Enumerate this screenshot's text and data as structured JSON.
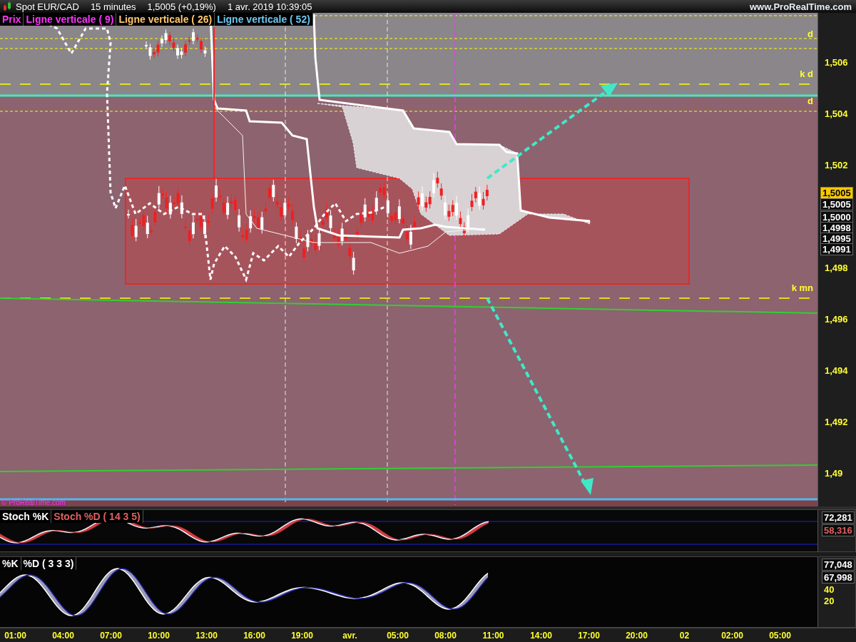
{
  "header": {
    "symbol": "Spot EUR/CAD",
    "interval": "15 minutes",
    "price": "1,5005 (+0,19%)",
    "datetime": "1 avr. 2019 10:39:05",
    "site": "www.ProRealTime.com"
  },
  "legend": [
    "Prix",
    "Ligne verticale ( 9)",
    "Ligne verticale ( 26)",
    "Ligne verticale ( 52)"
  ],
  "level_labels": [
    "d",
    "k d",
    "d",
    "k mn"
  ],
  "copyright": "© ProRealTime.com",
  "price_axis": {
    "ticks": [
      "1,506",
      "1,504",
      "1,502",
      "1,498",
      "1,496",
      "1,494",
      "1,492",
      "1,49"
    ],
    "tags": [
      {
        "value": "1,5005",
        "kind": "current"
      },
      {
        "value": "1,5005",
        "kind": "line"
      },
      {
        "value": "1,5000",
        "kind": "line"
      },
      {
        "value": "1,4998",
        "kind": "line"
      },
      {
        "value": "1,4995",
        "kind": "line"
      },
      {
        "value": "1,4991",
        "kind": "line"
      }
    ]
  },
  "stoch_panel": {
    "legend": [
      "Stoch %K",
      "Stoch %D ( 14 3 5)"
    ],
    "tags": [
      {
        "value": "72,281",
        "color": "#ffffff"
      },
      {
        "value": "58,316",
        "color": "#e06060"
      }
    ]
  },
  "kd_panel": {
    "legend": [
      "%K",
      "%D ( 3 3 3)"
    ],
    "tags": [
      {
        "value": "77,048",
        "color": "#ffffff"
      },
      {
        "value": "67,998",
        "color": "#ffffff"
      }
    ],
    "ticks": [
      "40",
      "20"
    ]
  },
  "time_axis": [
    "01:00",
    "04:00",
    "07:00",
    "10:00",
    "13:00",
    "16:00",
    "19:00",
    "avr.",
    "05:00",
    "08:00",
    "11:00",
    "14:00",
    "17:00",
    "20:00",
    "02",
    "02:00",
    "05:00"
  ]
}
